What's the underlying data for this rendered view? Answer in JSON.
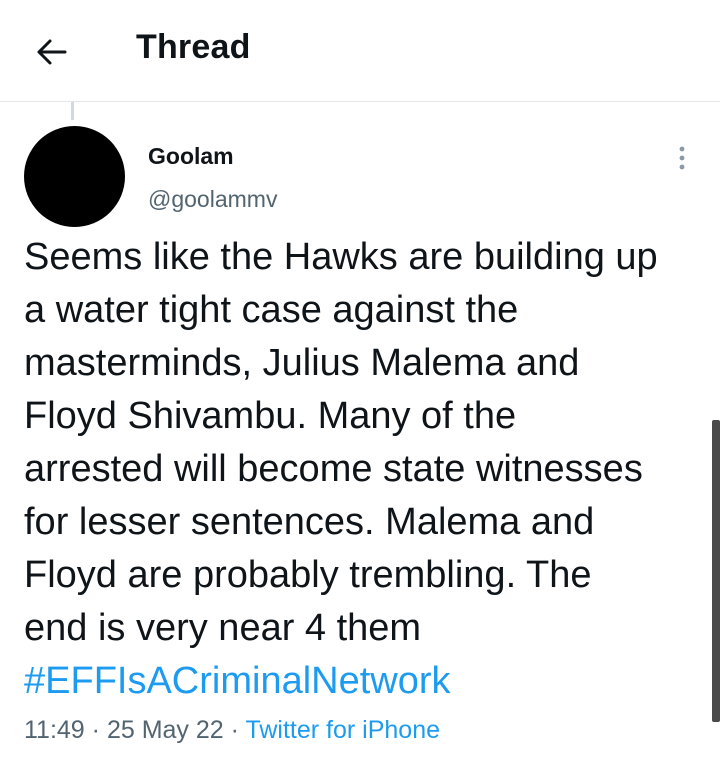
{
  "header": {
    "title": "Thread",
    "back_icon": "arrow-left-icon"
  },
  "tweet": {
    "author_name": "Goolam",
    "author_handle": "@goolammv",
    "more_icon": "more-vertical-icon",
    "text": "Seems like the Hawks are building up\na water tight case against the\nmasterminds, Julius Malema and\nFloyd Shivambu. Many of the\narrested will become state witnesses\nfor lesser sentences.  Malema and\nFloyd are probably trembling. The\nend is very near 4 them",
    "hashtag": "#EFFIsACriminalNetwork",
    "time": "11:49",
    "date": "25 May 22",
    "separator": "·",
    "source": "Twitter for iPhone"
  },
  "colors": {
    "link": "#1d9bf0",
    "secondary_text": "#536471",
    "primary_text": "#0f1419",
    "avatar": "#000000"
  }
}
